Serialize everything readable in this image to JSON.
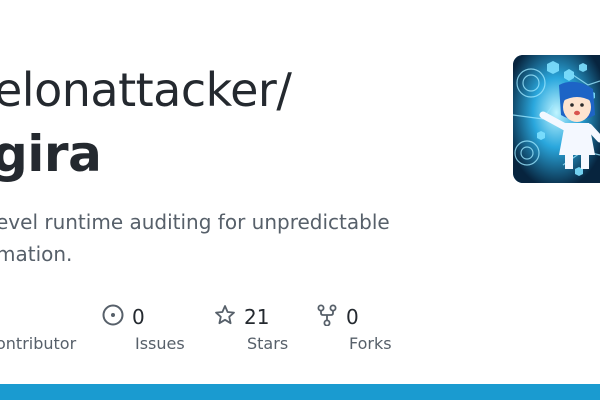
{
  "repo": {
    "owner_line": "elonattacker/",
    "name": "gira",
    "description_lines": [
      "evel runtime auditing for unpredictable",
      "mation."
    ]
  },
  "stats": [
    {
      "icon": "contributors-icon",
      "value": "",
      "label": "ontributor"
    },
    {
      "icon": "issues-icon",
      "value": "0",
      "label": "Issues"
    },
    {
      "icon": "star-icon",
      "value": "21",
      "label": "Stars"
    },
    {
      "icon": "fork-icon",
      "value": "0",
      "label": "Forks"
    }
  ],
  "colors": {
    "text": "#24292f",
    "muted": "#57606a",
    "bottom_bar": "#1a9bd0"
  }
}
